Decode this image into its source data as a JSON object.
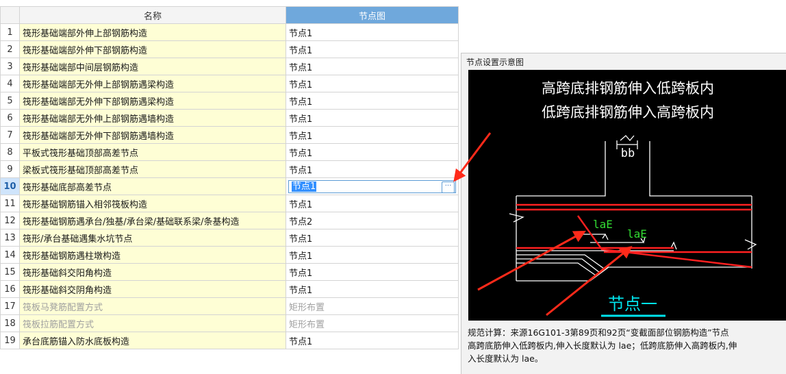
{
  "table": {
    "headers": {
      "name": "名称",
      "node": "节点图"
    },
    "selected_row": 10,
    "rows": [
      {
        "no": "1",
        "name": "筏形基础端部外伸上部钢筋构造",
        "node": "节点1",
        "disabled": false
      },
      {
        "no": "2",
        "name": "筏形基础端部外伸下部钢筋构造",
        "node": "节点1",
        "disabled": false
      },
      {
        "no": "3",
        "name": "筏形基础端部中间层钢筋构造",
        "node": "节点1",
        "disabled": false
      },
      {
        "no": "4",
        "name": "筏形基础端部无外伸上部钢筋遇梁构造",
        "node": "节点1",
        "disabled": false
      },
      {
        "no": "5",
        "name": "筏形基础端部无外伸下部钢筋遇梁构造",
        "node": "节点1",
        "disabled": false
      },
      {
        "no": "6",
        "name": "筏形基础端部无外伸上部钢筋遇墙构造",
        "node": "节点1",
        "disabled": false
      },
      {
        "no": "7",
        "name": "筏形基础端部无外伸下部钢筋遇墙构造",
        "node": "节点1",
        "disabled": false
      },
      {
        "no": "8",
        "name": "平板式筏形基础顶部高差节点",
        "node": "节点1",
        "disabled": false
      },
      {
        "no": "9",
        "name": "梁板式筏形基础顶部高差节点",
        "node": "节点1",
        "disabled": false
      },
      {
        "no": "10",
        "name": "筏形基础底部高差节点",
        "node": "节点1",
        "disabled": false
      },
      {
        "no": "11",
        "name": "筏形基础钢筋锚入相邻筏板构造",
        "node": "节点1",
        "disabled": false
      },
      {
        "no": "12",
        "name": "筏形基础钢筋遇承台/独基/承台梁/基础联系梁/条基构造",
        "node": "节点2",
        "disabled": false
      },
      {
        "no": "13",
        "name": "筏形/承台基础遇集水坑节点",
        "node": "节点1",
        "disabled": false
      },
      {
        "no": "14",
        "name": "筏形基础钢筋遇柱墩构造",
        "node": "节点1",
        "disabled": false
      },
      {
        "no": "15",
        "name": "筏形基础斜交阳角构造",
        "node": "节点1",
        "disabled": false
      },
      {
        "no": "16",
        "name": "筏形基础斜交阴角构造",
        "node": "节点1",
        "disabled": false
      },
      {
        "no": "17",
        "name": "筏板马凳筋配置方式",
        "node": "矩形布置",
        "disabled": true
      },
      {
        "no": "18",
        "name": "筏板拉筋配置方式",
        "node": "矩形布置",
        "disabled": true
      },
      {
        "no": "19",
        "name": "承台底筋锚入防水底板构造",
        "node": "节点1",
        "disabled": false
      }
    ],
    "more_button": "···"
  },
  "panel": {
    "title": "节点设置示意图",
    "diagram": {
      "line1": "高跨底排钢筋伸入低跨板内",
      "line2": "低跨底排钢筋伸入高跨板内",
      "dim_label": "bb",
      "anchor_label_1": "laE",
      "anchor_label_2": "laE",
      "node_caption": "节点一"
    },
    "footnote": [
      "规范计算：来源16G101-3第89页和92页“变截面部位钢筋构造”节点",
      "高跨底筋伸入低跨板内,伸入长度默认为 lae；低跨底筋伸入高跨板内,伸",
      "入长度默认为 lae。"
    ]
  },
  "colors": {
    "header_node_bg": "#6fa8dc",
    "name_cell_bg": "#fefed5",
    "rebar_red": "#ff2020",
    "annotation_green": "#33dd33",
    "caption_cyan": "#00e5ee",
    "arrow_red": "#ff2a1a"
  }
}
